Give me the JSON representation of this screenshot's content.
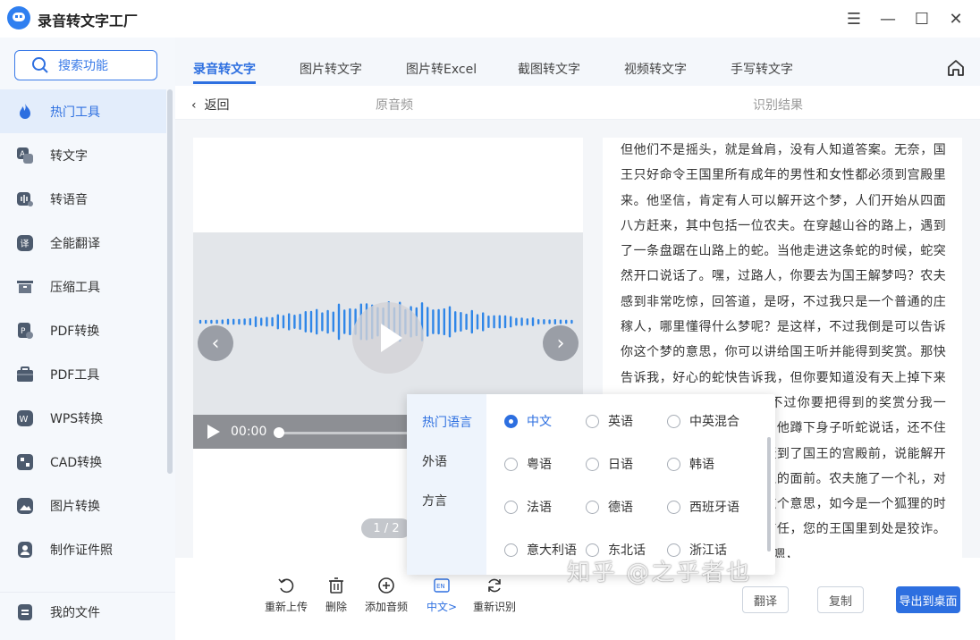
{
  "app": {
    "title": "录音转文字工厂"
  },
  "window": {
    "menu": "☰",
    "minimize": "—",
    "maximize": "☐",
    "close": "✕"
  },
  "sidebar": {
    "search_label": "搜索功能",
    "items": [
      {
        "label": "热门工具",
        "icon": "flame-icon"
      },
      {
        "label": "转文字",
        "icon": "text-convert-icon"
      },
      {
        "label": "转语音",
        "icon": "voice-icon"
      },
      {
        "label": "全能翻译",
        "icon": "translate-icon"
      },
      {
        "label": "压缩工具",
        "icon": "compress-icon"
      },
      {
        "label": "PDF转换",
        "icon": "pdf-convert-icon"
      },
      {
        "label": "PDF工具",
        "icon": "pdf-tools-icon"
      },
      {
        "label": "WPS转换",
        "icon": "wps-icon"
      },
      {
        "label": "CAD转换",
        "icon": "cad-icon"
      },
      {
        "label": "图片转换",
        "icon": "image-icon"
      },
      {
        "label": "制作证件照",
        "icon": "id-photo-icon"
      }
    ],
    "my_files": "我的文件"
  },
  "tabs": [
    "录音转文字",
    "图片转文字",
    "图片转Excel",
    "截图转文字",
    "视频转文字",
    "手写转文字"
  ],
  "subbar": {
    "back": "返回",
    "original_audio": "原音频",
    "result": "识别结果"
  },
  "player": {
    "time": "00:00",
    "page": "1 / 2"
  },
  "result_text": "但他们不是摇头，就是耸肩，没有人知道答案。无奈，国王只好命令王国里所有成年的男性和女性都必须到宫殿里来。他坚信，肯定有人可以解开这个梦，人们开始从四面八方赶来，其中包括一位农夫。在穿越山谷的路上，遇到了一条盘踞在山路上的蛇。当他走进这条蛇的时候，蛇突然开口说话了。嘿，过路人，你要去为国王解梦吗？农夫感到非常吃惊，回答道，是呀，不过我只是一个普通的庄稼人，哪里懂得什么梦呢？是这样，不过我倒是可以告诉你这个梦的意思，你可以讲给国王听并能得到奖赏。那快告诉我，好心的蛇快告诉我，但你要知道没有天上掉下来的好事，我可以告诉你，不过你要把得到的奖赏分我一半。农夫答应了蛇的要求，他蹲下身子听蛇说话，还不住地点头。农夫一路小跑，赶到了国王的宫殿前，说能解开国王的梦。他被带到了国王的面前。农夫施了一个礼，对国王说，陛下，您的梦是这个意思，如今是一个狐狸的时代，我们中间没有人值得信任，您的王国里到处是狡诈。国王点了点头，若有所思，嗯，",
  "toolbar": {
    "reupload": "重新上传",
    "delete": "删除",
    "add_audio": "添加音频",
    "language": "中文>",
    "re_recognize": "重新识别",
    "btn_a": "翻译",
    "btn_b": "复制",
    "btn_c": "导出到桌面",
    "lang_badge": "EN"
  },
  "language_popup": {
    "categories": [
      "热门语言",
      "外语",
      "方言"
    ],
    "options": [
      [
        "中文",
        "英语",
        "中英混合"
      ],
      [
        "粤语",
        "日语",
        "韩语"
      ],
      [
        "法语",
        "德语",
        "西班牙语"
      ],
      [
        "意大利语",
        "东北话",
        "浙江话"
      ]
    ],
    "selected": "中文"
  },
  "watermark": "知乎 @之乎者也",
  "colors": {
    "accent": "#2d6fe0",
    "wave": "#2f86e8"
  }
}
